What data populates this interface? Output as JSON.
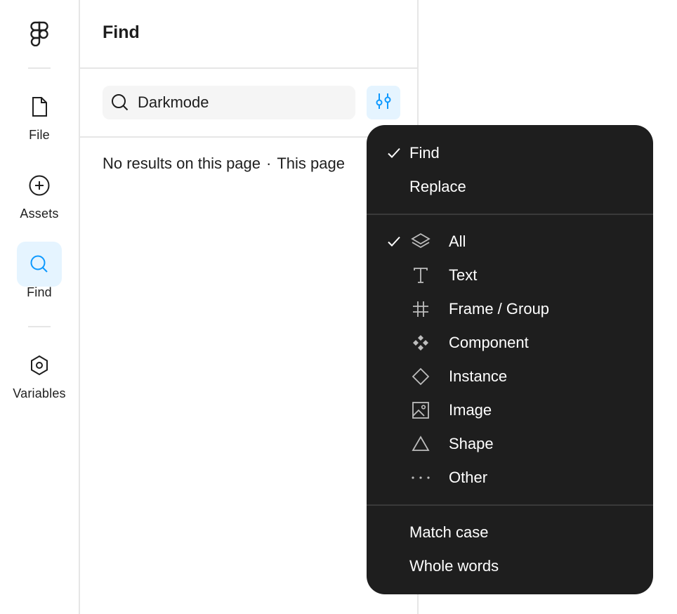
{
  "rail": {
    "logo": "figma-logo-icon",
    "items": [
      {
        "label": "File",
        "icon": "file-icon"
      },
      {
        "label": "Assets",
        "icon": "plus-circle-icon"
      },
      {
        "label": "Find",
        "icon": "search-icon",
        "active": true
      },
      {
        "label": "Variables",
        "icon": "hexagon-icon"
      }
    ]
  },
  "panel": {
    "title": "Find",
    "search_value": "Darkmode",
    "results_text": "No results on this page",
    "results_separator": "·",
    "results_scope": "This page"
  },
  "menu": {
    "mode": [
      {
        "label": "Find",
        "checked": true
      },
      {
        "label": "Replace",
        "checked": false
      }
    ],
    "types": [
      {
        "label": "All",
        "icon": "layers-icon",
        "checked": true
      },
      {
        "label": "Text",
        "icon": "text-icon",
        "checked": false
      },
      {
        "label": "Frame / Group",
        "icon": "frame-icon",
        "checked": false
      },
      {
        "label": "Component",
        "icon": "component-icon",
        "checked": false
      },
      {
        "label": "Instance",
        "icon": "instance-icon",
        "checked": false
      },
      {
        "label": "Image",
        "icon": "image-icon",
        "checked": false
      },
      {
        "label": "Shape",
        "icon": "shape-icon",
        "checked": false
      },
      {
        "label": "Other",
        "icon": "more-icon",
        "checked": false
      }
    ],
    "options": [
      {
        "label": "Match case",
        "checked": false
      },
      {
        "label": "Whole words",
        "checked": false
      }
    ]
  },
  "colors": {
    "accent": "#0d99ff",
    "accent_bg": "#e5f4ff",
    "menu_bg": "#1e1e1e"
  }
}
